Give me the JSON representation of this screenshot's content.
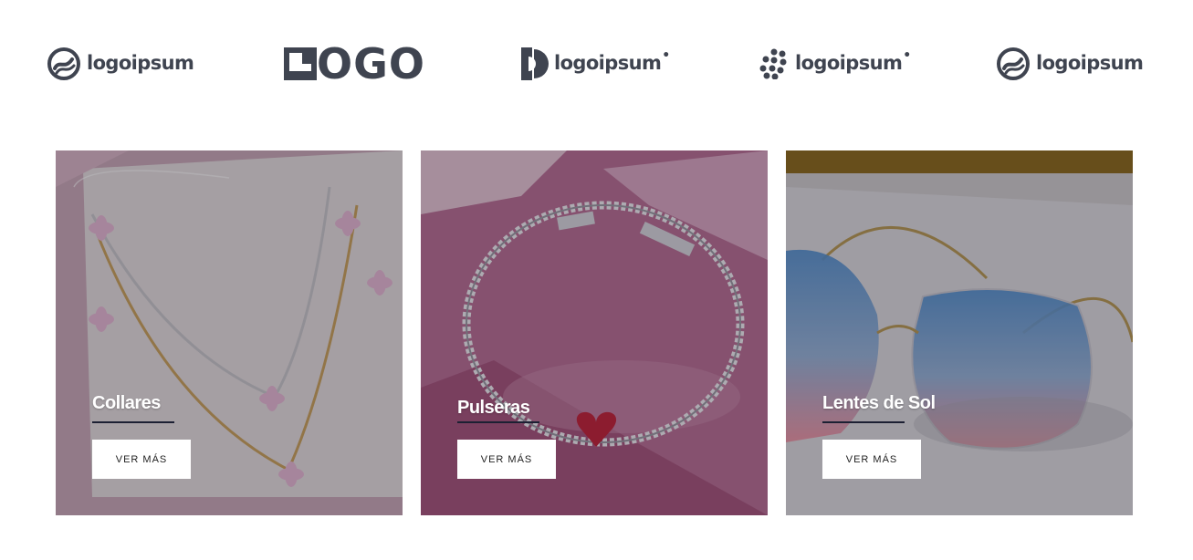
{
  "logos": [
    {
      "name": "logoipsum-ring",
      "text": "logoipsum",
      "mark": ""
    },
    {
      "name": "logo-block",
      "text": "OGO",
      "mark": ""
    },
    {
      "name": "logoipsum-half-circle",
      "text": "logoipsum",
      "mark": "•"
    },
    {
      "name": "logoipsum-dots",
      "text": "logoipsum",
      "mark": "•"
    },
    {
      "name": "logoipsum-ring-2",
      "text": "logoipsum",
      "mark": ""
    }
  ],
  "cards": [
    {
      "title": "Collares",
      "button": "VER MÁS"
    },
    {
      "title": "Pulseras",
      "button": "VER MÁS"
    },
    {
      "title": "Lentes de Sol",
      "button": "VER MÁS"
    }
  ],
  "colors": {
    "logo": "#3f4450",
    "underline": "#1c2033",
    "overlay_text": "#ffffff",
    "button_bg": "#ffffff"
  }
}
